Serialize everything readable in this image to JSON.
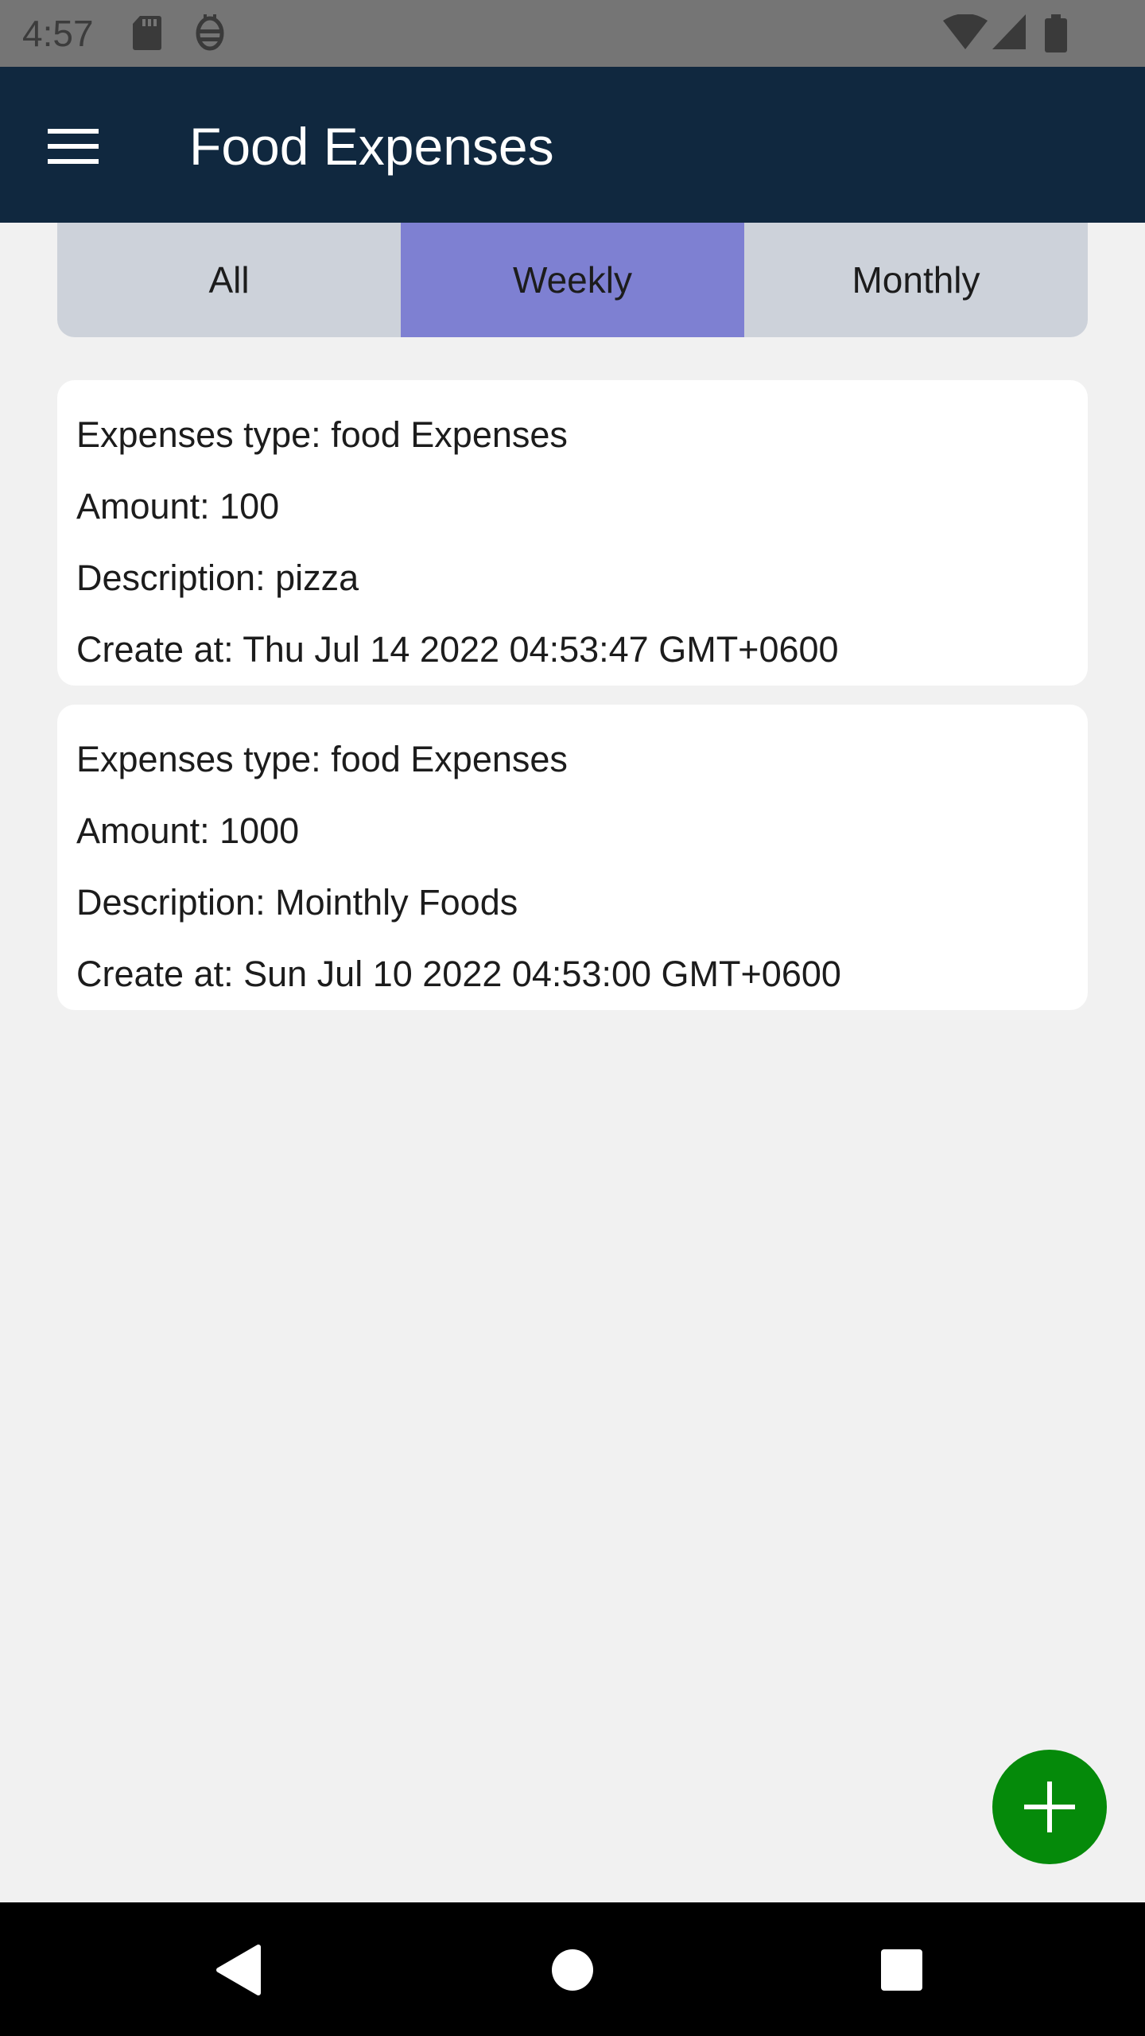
{
  "status_bar": {
    "time": "4:57",
    "icons": [
      "sd-card-icon",
      "debug-icon",
      "wifi-icon",
      "signal-icon",
      "battery-icon"
    ]
  },
  "app_bar": {
    "title": "Food Expenses",
    "menu_icon": "hamburger-menu-icon"
  },
  "tabs": [
    {
      "label": "All",
      "active": false
    },
    {
      "label": "Weekly",
      "active": true
    },
    {
      "label": "Monthly",
      "active": false
    }
  ],
  "expenses": [
    {
      "type_label": "Expenses type: ",
      "type_value": "food Expenses",
      "amount_label": "Amount: ",
      "amount_value": "100",
      "description_label": "Description: ",
      "description_value": "pizza",
      "created_label": "Create at: ",
      "created_value": "Thu Jul 14 2022 04:53:47 GMT+0600"
    },
    {
      "type_label": "Expenses type: ",
      "type_value": "food Expenses",
      "amount_label": "Amount: ",
      "amount_value": "1000",
      "description_label": "Description: ",
      "description_value": "Mointhly Foods",
      "created_label": "Create at: ",
      "created_value": "Sun Jul 10 2022 04:53:00 GMT+0600"
    }
  ],
  "fab": {
    "icon": "plus-icon"
  },
  "nav_bar": {
    "icons": [
      "back-icon",
      "home-icon",
      "recents-icon"
    ]
  },
  "colors": {
    "app_bar": "#10283f",
    "tab_active": "#7e80d2",
    "tab_inactive": "#cdd2da",
    "fab": "#058a0a",
    "background": "#f1f1f1"
  }
}
